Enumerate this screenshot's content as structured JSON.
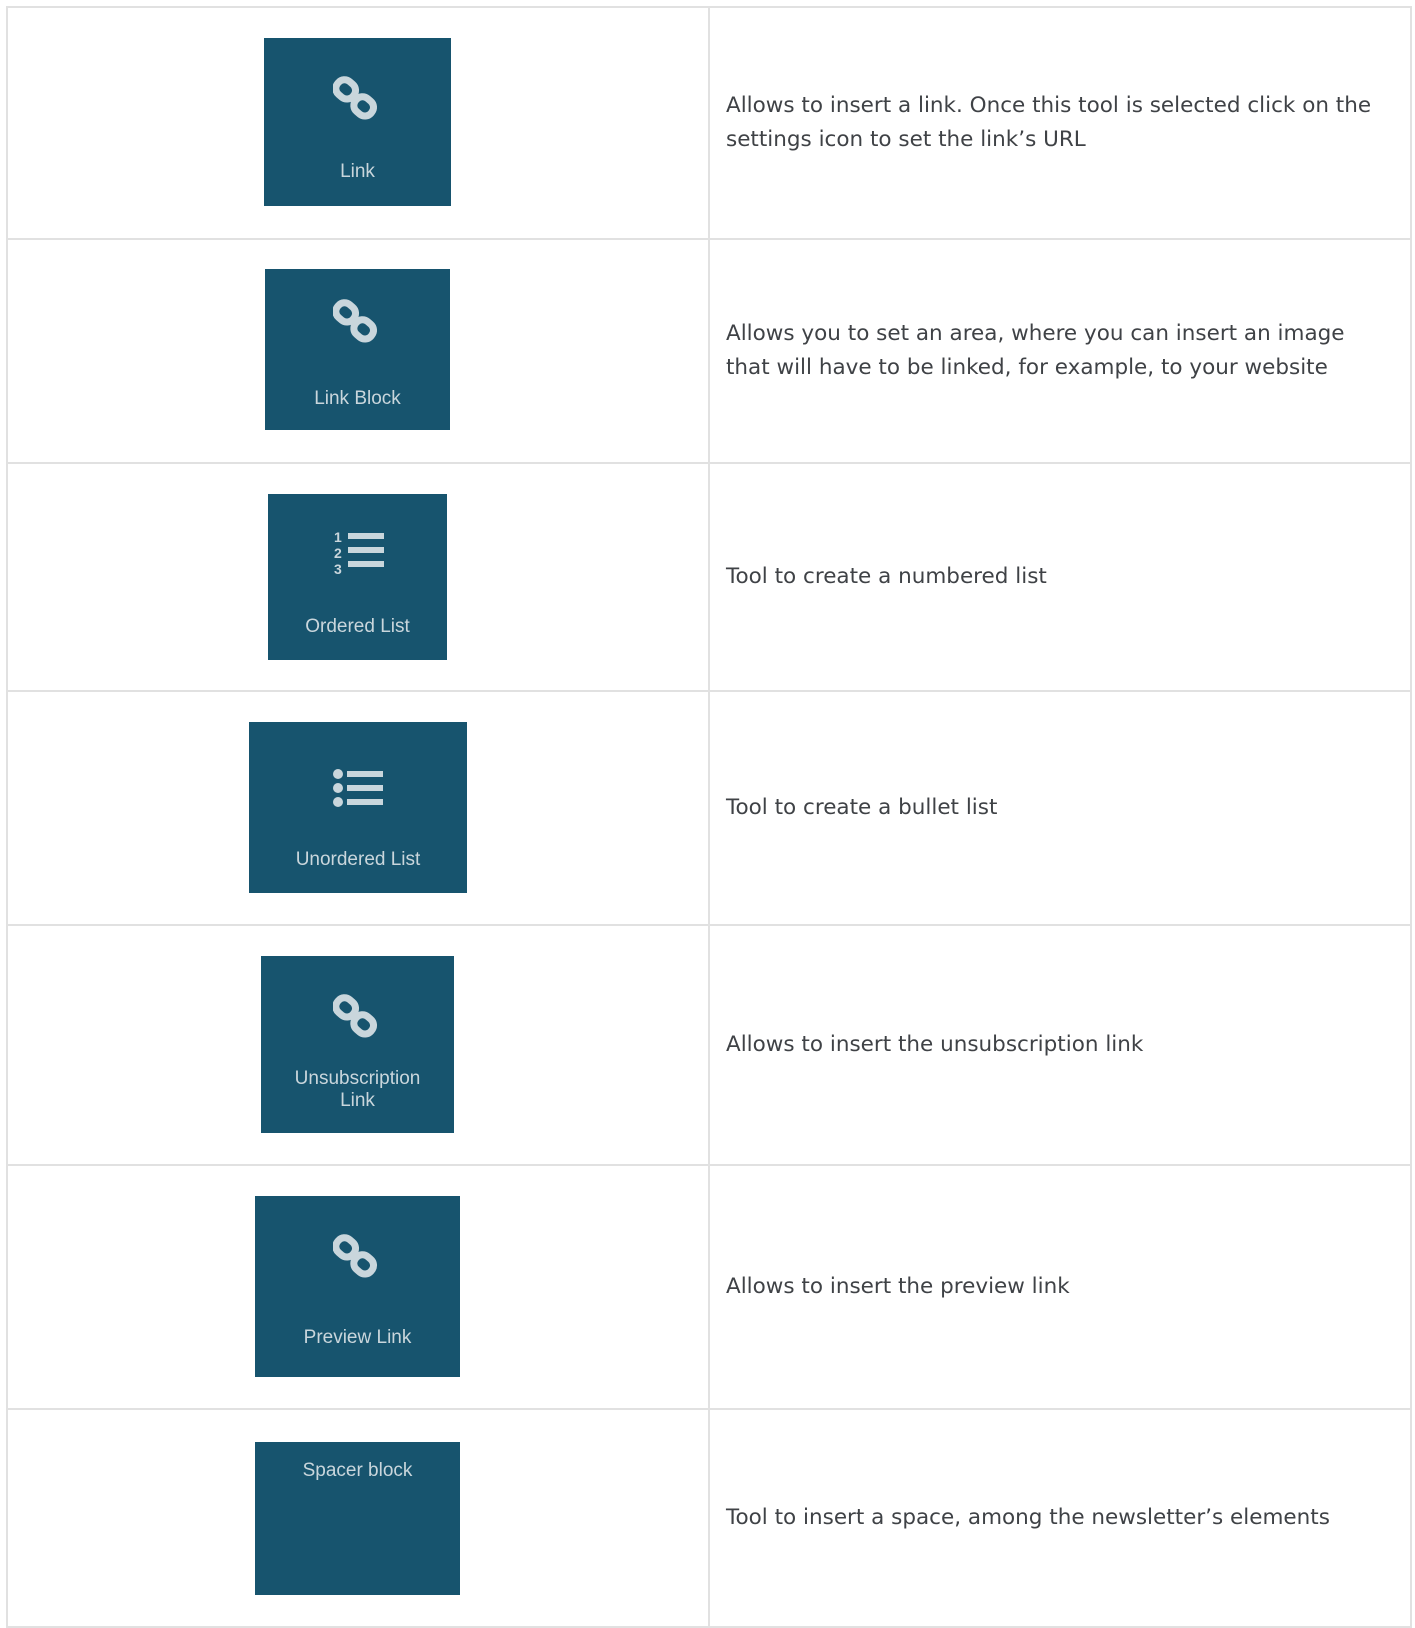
{
  "rows": [
    {
      "icon": "link-icon",
      "tile_label": "Link",
      "description": "Allows to insert a link. Once this tool is selected click on the settings icon to set the link’s URL"
    },
    {
      "icon": "link-icon",
      "tile_label": "Link Block",
      "description": "Allows you to set an area, where you can insert an image that will have to be linked, for example, to your website"
    },
    {
      "icon": "ordered-list-icon",
      "tile_label": "Ordered List",
      "description": "Tool to create a numbered list"
    },
    {
      "icon": "unordered-list-icon",
      "tile_label": "Unordered List",
      "description": "Tool to create a bullet list"
    },
    {
      "icon": "link-icon",
      "tile_label": "Unsubscription\nLink",
      "description": "Allows to insert the unsubscription link"
    },
    {
      "icon": "link-icon",
      "tile_label": "Preview Link",
      "description": "Allows to insert the preview link"
    },
    {
      "icon": "",
      "tile_label": "Spacer block",
      "description": "Tool to insert a space, among the newsletter’s elements"
    }
  ],
  "colors": {
    "tile_background": "#17546e",
    "tile_text": "#c9d6dc",
    "border": "#e1e1e1",
    "description_text": "#3f4246"
  }
}
